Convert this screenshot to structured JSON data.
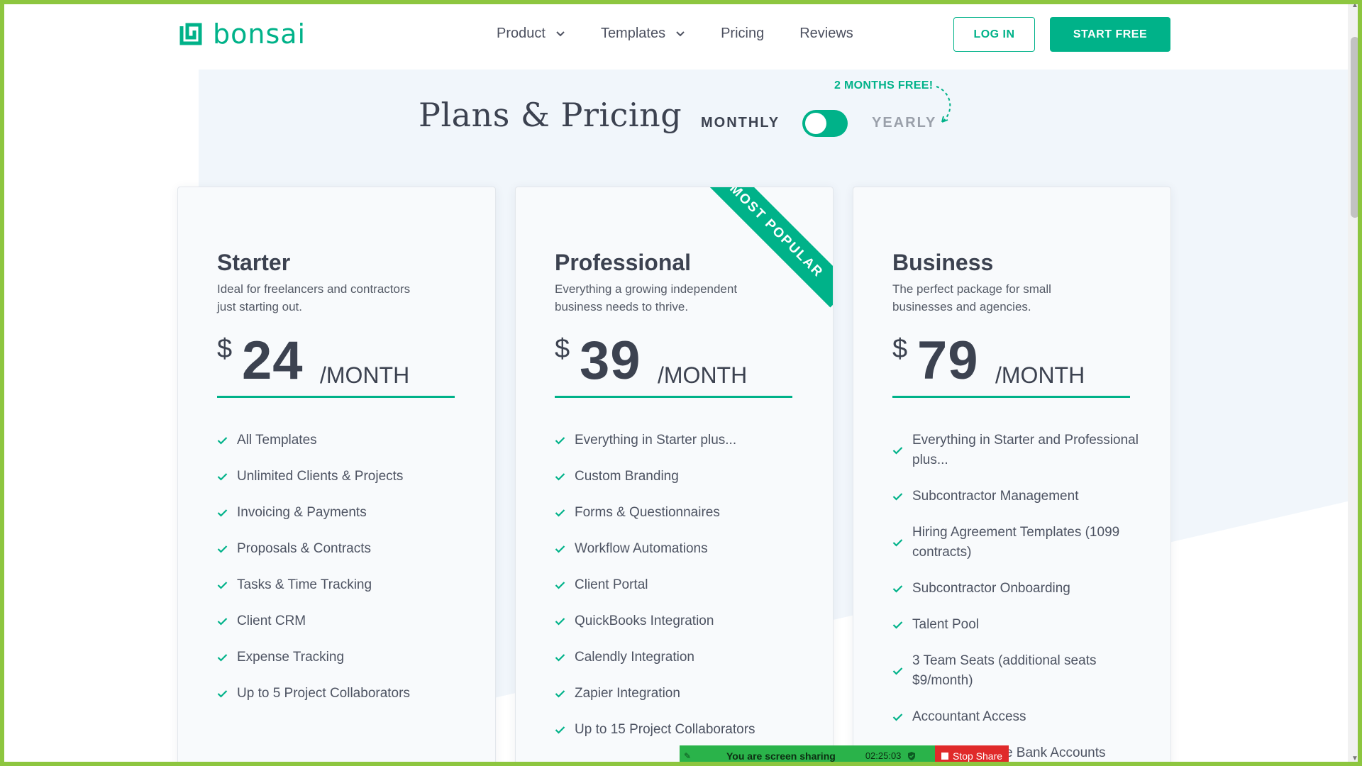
{
  "nav": {
    "logo_text": "bonsai",
    "brand_color": "#00b289",
    "links": [
      "Product",
      "Templates",
      "Pricing",
      "Reviews"
    ],
    "login_label": "LOG IN",
    "start_label": "START FREE"
  },
  "hero": {
    "title": "Plans & Pricing",
    "monthly_label": "MONTHLY",
    "yearly_label": "YEARLY",
    "promo": "2 MONTHS FREE!"
  },
  "plans": [
    {
      "name": "Starter",
      "description": "Ideal for freelancers and contractors just starting out.",
      "currency": "$",
      "price": "24",
      "period": "/MONTH",
      "features": [
        "All Templates",
        "Unlimited Clients & Projects",
        "Invoicing & Payments",
        "Proposals & Contracts",
        "Tasks & Time Tracking",
        "Client CRM",
        "Expense Tracking",
        "Up to 5 Project Collaborators"
      ]
    },
    {
      "name": "Professional",
      "description": "Everything a growing independent business needs to thrive.",
      "currency": "$",
      "price": "39",
      "period": "/MONTH",
      "ribbon": "MOST POPULAR",
      "features": [
        "Everything in Starter plus...",
        "Custom Branding",
        "Forms & Questionnaires",
        "Workflow Automations",
        "Client Portal",
        "QuickBooks Integration",
        "Calendly Integration",
        "Zapier Integration",
        "Up to 15 Project Collaborators"
      ]
    },
    {
      "name": "Business",
      "description": "The perfect package for small businesses and agencies.",
      "currency": "$",
      "price": "79",
      "period": "/MONTH",
      "features": [
        "Everything in Starter and Professional plus...",
        "Subcontractor Management",
        "Hiring Agreement Templates (1099 contracts)",
        "Subcontractor Onboarding",
        "Talent Pool",
        "3 Team Seats (additional seats $9/month)",
        "Accountant Access",
        "Connect Multiple Bank Accounts"
      ]
    }
  ],
  "share_bar": {
    "text": "You are screen sharing",
    "timer": "02:25:03",
    "stop_label": "Stop Share"
  }
}
